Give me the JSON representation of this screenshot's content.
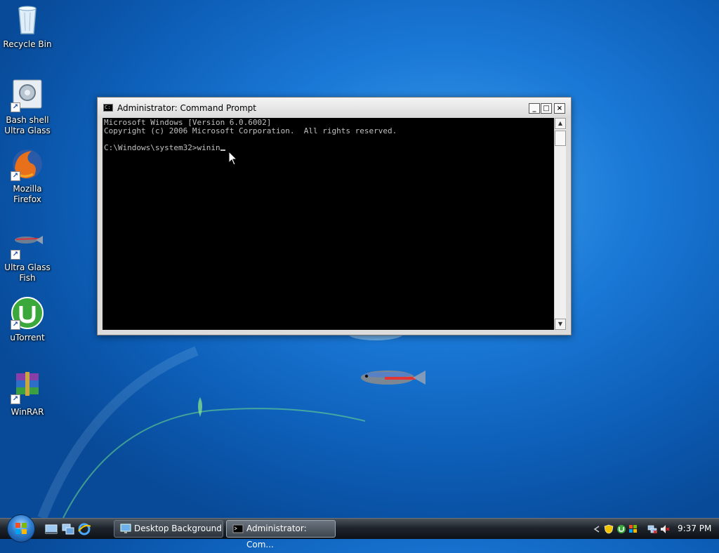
{
  "desktop": {
    "icons": [
      {
        "label": "Recycle Bin",
        "icon": "recycle-bin-icon"
      },
      {
        "label": "Bash shell\nUltra Glass",
        "icon": "bash-shell-icon"
      },
      {
        "label": "Mozilla\nFirefox",
        "icon": "firefox-icon"
      },
      {
        "label": "Ultra Glass\nFish",
        "icon": "fish-icon"
      },
      {
        "label": "uTorrent",
        "icon": "utorrent-icon"
      },
      {
        "label": "WinRAR",
        "icon": "winrar-icon"
      }
    ]
  },
  "cmd_window": {
    "title": "Administrator: Command Prompt",
    "lines": [
      "Microsoft Windows [Version 6.0.6002]",
      "Copyright (c) 2006 Microsoft Corporation.  All rights reserved.",
      "",
      "C:\\Windows\\system32>winin"
    ],
    "minimize": "_",
    "maximize": "□",
    "close": "×"
  },
  "taskbar": {
    "buttons": [
      {
        "label": "Desktop Background"
      },
      {
        "label": "Administrator: Com..."
      }
    ],
    "clock": "9:37 PM"
  },
  "colors": {
    "desktop": "#1a78d6",
    "console_bg": "#000000",
    "console_text": "#c0c0c0"
  }
}
